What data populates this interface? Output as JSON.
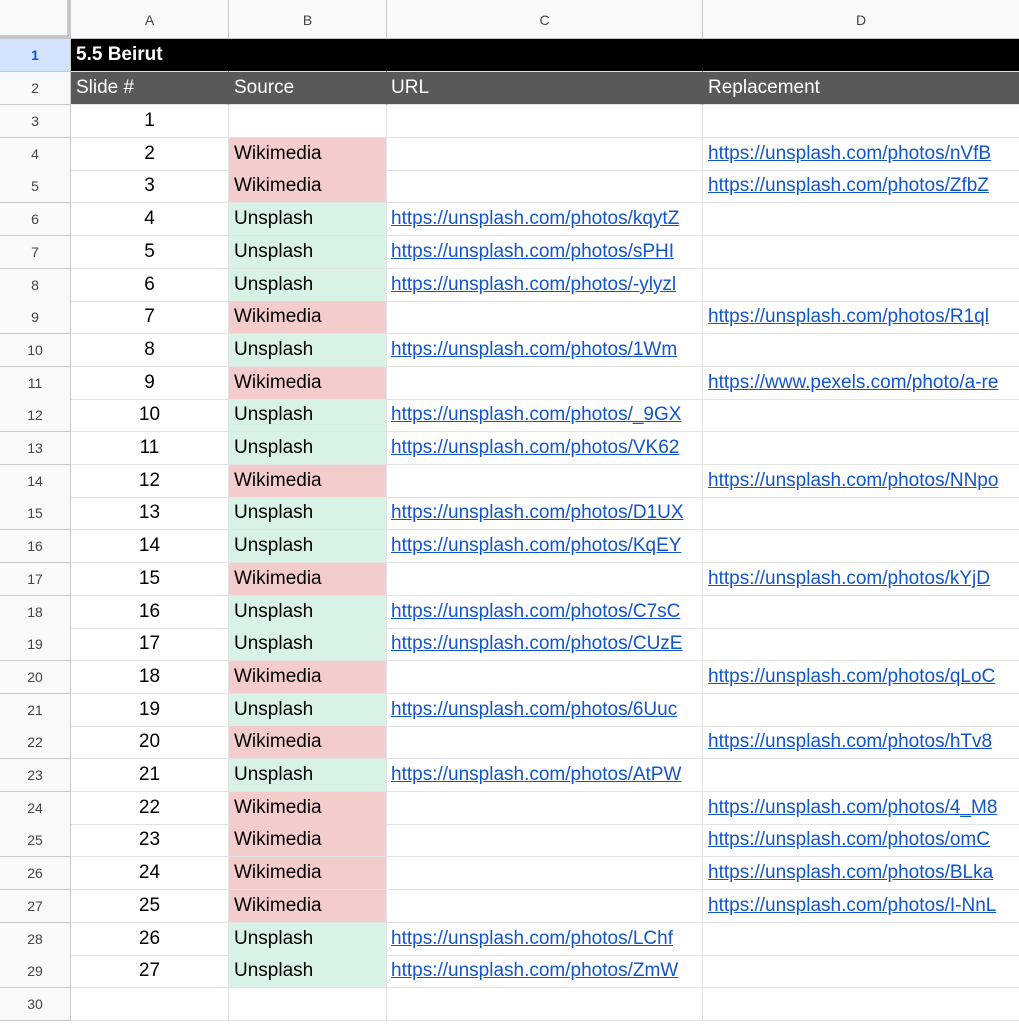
{
  "columns": [
    "A",
    "B",
    "C",
    "D"
  ],
  "title": "5.5 Beirut",
  "headers": [
    "Slide #",
    "Source",
    "URL",
    "Replacement"
  ],
  "colors": {
    "wikimedia": "#f4cccc",
    "unsplash": "#d9f2e6",
    "title_bg": "#000000",
    "header_bg": "#595959",
    "link": "#1155cc"
  },
  "rows": [
    {
      "num": "3",
      "slide": "1",
      "source": "",
      "url": "",
      "replacement": ""
    },
    {
      "num": "4",
      "slide": "2",
      "source": "Wikimedia",
      "url": "",
      "replacement": "https://unsplash.com/photos/nVfB"
    },
    {
      "num": "5",
      "slide": "3",
      "source": "Wikimedia",
      "url": "",
      "replacement": "https://unsplash.com/photos/ZfbZ"
    },
    {
      "num": "6",
      "slide": "4",
      "source": "Unsplash",
      "url": "https://unsplash.com/photos/kqytZ",
      "replacement": ""
    },
    {
      "num": "7",
      "slide": "5",
      "source": "Unsplash",
      "url": "https://unsplash.com/photos/sPHI",
      "replacement": ""
    },
    {
      "num": "8",
      "slide": "6",
      "source": "Unsplash",
      "url": "https://unsplash.com/photos/-ylyzl",
      "replacement": ""
    },
    {
      "num": "9",
      "slide": "7",
      "source": "Wikimedia",
      "url": "",
      "replacement": "https://unsplash.com/photos/R1ql"
    },
    {
      "num": "10",
      "slide": "8",
      "source": "Unsplash",
      "url": "https://unsplash.com/photos/1Wm",
      "replacement": ""
    },
    {
      "num": "11",
      "slide": "9",
      "source": "Wikimedia",
      "url": "",
      "replacement": "https://www.pexels.com/photo/a-re"
    },
    {
      "num": "12",
      "slide": "10",
      "source": "Unsplash",
      "url": "https://unsplash.com/photos/_9GX",
      "replacement": ""
    },
    {
      "num": "13",
      "slide": "11",
      "source": "Unsplash",
      "url": "https://unsplash.com/photos/VK62",
      "replacement": ""
    },
    {
      "num": "14",
      "slide": "12",
      "source": "Wikimedia",
      "url": "",
      "replacement": "https://unsplash.com/photos/NNpo"
    },
    {
      "num": "15",
      "slide": "13",
      "source": "Unsplash",
      "url": "https://unsplash.com/photos/D1UX",
      "replacement": ""
    },
    {
      "num": "16",
      "slide": "14",
      "source": "Unsplash",
      "url": "https://unsplash.com/photos/KqEY",
      "replacement": ""
    },
    {
      "num": "17",
      "slide": "15",
      "source": "Wikimedia",
      "url": "",
      "replacement": "https://unsplash.com/photos/kYjD"
    },
    {
      "num": "18",
      "slide": "16",
      "source": "Unsplash",
      "url": "https://unsplash.com/photos/C7sC",
      "replacement": ""
    },
    {
      "num": "19",
      "slide": "17",
      "source": "Unsplash",
      "url": "https://unsplash.com/photos/CUzE",
      "replacement": ""
    },
    {
      "num": "20",
      "slide": "18",
      "source": "Wikimedia",
      "url": "",
      "replacement": "https://unsplash.com/photos/qLoC"
    },
    {
      "num": "21",
      "slide": "19",
      "source": "Unsplash",
      "url": "https://unsplash.com/photos/6Uuc",
      "replacement": ""
    },
    {
      "num": "22",
      "slide": "20",
      "source": "Wikimedia",
      "url": "",
      "replacement": "https://unsplash.com/photos/hTv8"
    },
    {
      "num": "23",
      "slide": "21",
      "source": "Unsplash",
      "url": "https://unsplash.com/photos/AtPW",
      "replacement": ""
    },
    {
      "num": "24",
      "slide": "22",
      "source": "Wikimedia",
      "url": "",
      "replacement": "https://unsplash.com/photos/4_M8"
    },
    {
      "num": "25",
      "slide": "23",
      "source": "Wikimedia",
      "url": "",
      "replacement": "https://unsplash.com/photos/omC"
    },
    {
      "num": "26",
      "slide": "24",
      "source": "Wikimedia",
      "url": "",
      "replacement": "https://unsplash.com/photos/BLka"
    },
    {
      "num": "27",
      "slide": "25",
      "source": "Wikimedia",
      "url": "",
      "replacement": "https://unsplash.com/photos/I-NnL"
    },
    {
      "num": "28",
      "slide": "26",
      "source": "Unsplash",
      "url": "https://unsplash.com/photos/LChf",
      "replacement": ""
    },
    {
      "num": "29",
      "slide": "27",
      "source": "Unsplash",
      "url": "https://unsplash.com/photos/ZmW",
      "replacement": ""
    },
    {
      "num": "30",
      "slide": "",
      "source": "",
      "url": "",
      "replacement": ""
    }
  ]
}
